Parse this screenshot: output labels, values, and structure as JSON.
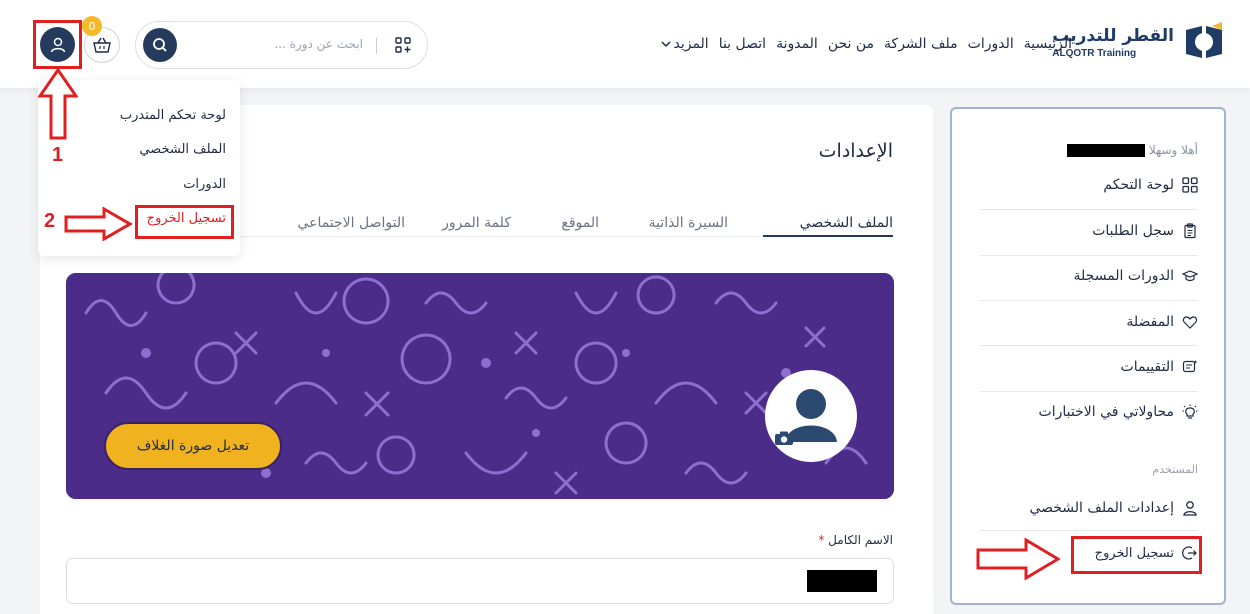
{
  "brand": {
    "name_ar": "القطر للتدريب",
    "name_en": "ALQOTR Training"
  },
  "nav": {
    "items": [
      "الرئيسية",
      "الدورات",
      "ملف الشركة",
      "من نحن",
      "المدونة",
      "اتصل بنا",
      "المزيد"
    ]
  },
  "search": {
    "placeholder": "ابحث عن دورة ..."
  },
  "cart": {
    "count": "0"
  },
  "annotations": {
    "step1": "1",
    "step2": "2"
  },
  "dropdown": {
    "items": [
      "لوحة تحكم المتدرب",
      "الملف الشخصي",
      "الدورات"
    ],
    "logout": "تسجيل الخروج"
  },
  "main": {
    "title": "الإعدادات",
    "tabs": [
      "الملف الشخصي",
      "السيرة الذاتية",
      "الموقع",
      "كلمة المرور",
      "التواصل الاجتماعي"
    ],
    "cover_button": "تعديل صورة الغلاف",
    "full_name_label": "الاسم الكامل",
    "required_mark": "*"
  },
  "sidebar": {
    "greeting": "أهلا وسهلا",
    "items": [
      "لوحة التحكم",
      "سجل الطلبات",
      "الدورات المسجلة",
      "المفضلة",
      "التقييمات",
      "محاولاتي في الاختبارات"
    ],
    "section_user": "المستخدم",
    "profile_settings": "إعدادات الملف الشخصي",
    "logout": "تسجيل الخروج"
  },
  "colors": {
    "primary": "#243b5e",
    "accent": "#f0b21e",
    "annotation": "#e02020",
    "cover": "#4b2c88"
  }
}
